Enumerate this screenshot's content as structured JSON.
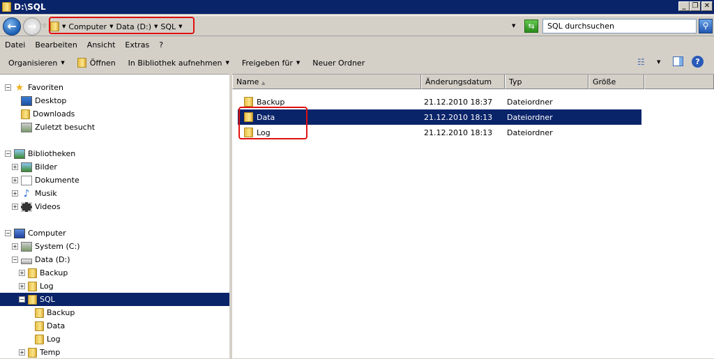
{
  "window": {
    "title": "D:\\SQL",
    "minimize": "_",
    "restore": "❐",
    "close": "✕"
  },
  "address": {
    "crumbs": [
      "Computer",
      "Data (D:)",
      "SQL"
    ],
    "search_placeholder": "SQL durchsuchen"
  },
  "menu": [
    "Datei",
    "Bearbeiten",
    "Ansicht",
    "Extras",
    "?"
  ],
  "toolbar": {
    "organize": "Organisieren",
    "open": "Öffnen",
    "library": "In Bibliothek aufnehmen",
    "share": "Freigeben für",
    "new_folder": "Neuer Ordner"
  },
  "tree": [
    {
      "label": "Favoriten"
    },
    {
      "label": "Desktop"
    },
    {
      "label": "Downloads"
    },
    {
      "label": "Zuletzt besucht"
    },
    {
      "label": "Bibliotheken"
    },
    {
      "label": "Bilder"
    },
    {
      "label": "Dokumente"
    },
    {
      "label": "Musik"
    },
    {
      "label": "Videos"
    },
    {
      "label": "Computer"
    },
    {
      "label": "System (C:)"
    },
    {
      "label": "Data (D:)"
    },
    {
      "label": "Backup"
    },
    {
      "label": "Log"
    },
    {
      "label": "SQL"
    },
    {
      "label": "Backup"
    },
    {
      "label": "Data"
    },
    {
      "label": "Log"
    },
    {
      "label": "Temp"
    }
  ],
  "columns": [
    "Name",
    "Änderungsdatum",
    "Typ",
    "Größe"
  ],
  "files": [
    {
      "name": "Backup",
      "date": "21.12.2010 18:37",
      "type": "Dateiordner"
    },
    {
      "name": "Data",
      "date": "21.12.2010 18:13",
      "type": "Dateiordner"
    },
    {
      "name": "Log",
      "date": "21.12.2010 18:13",
      "type": "Dateiordner"
    }
  ]
}
